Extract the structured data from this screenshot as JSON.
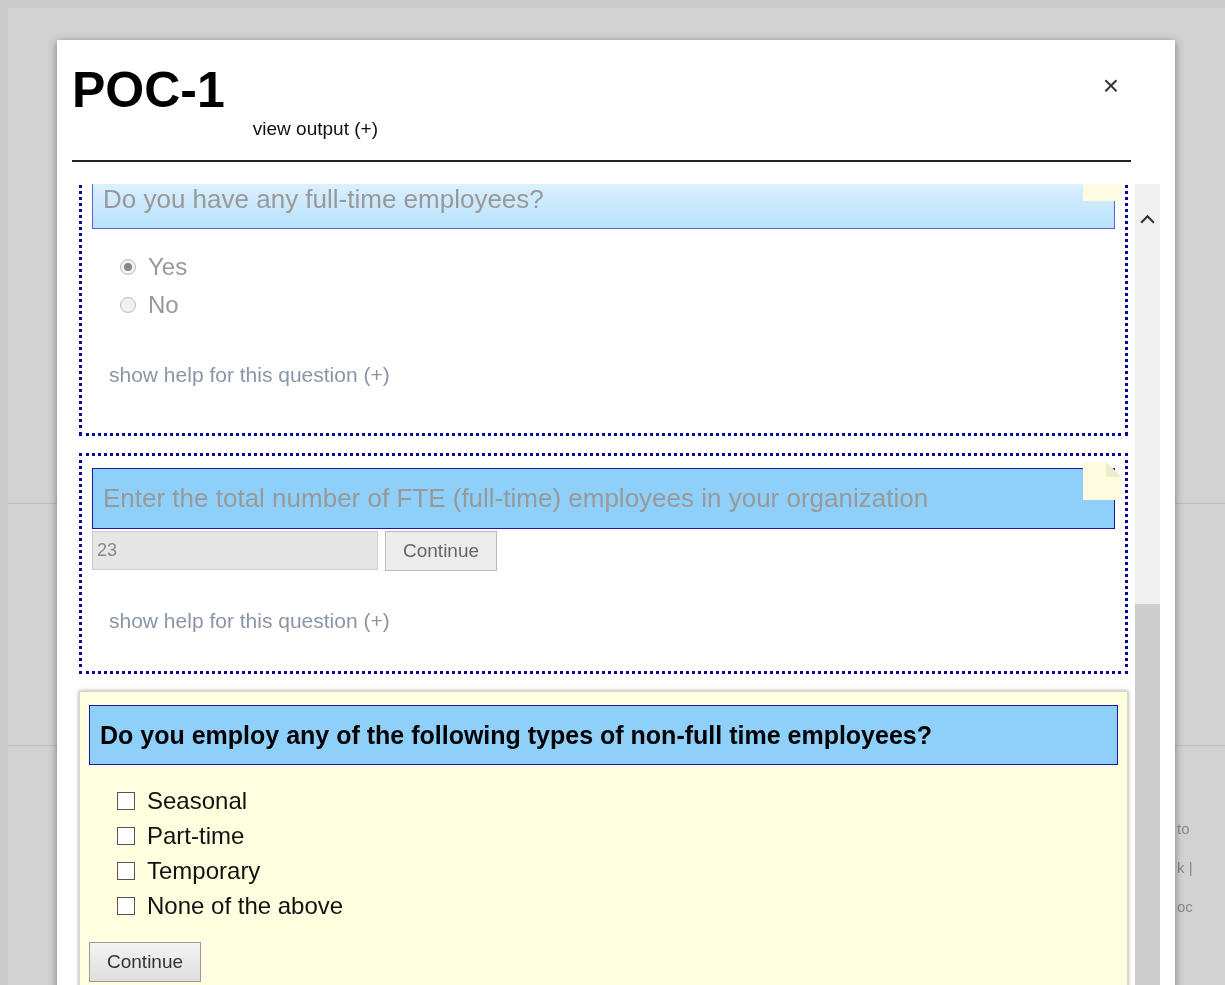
{
  "dialog": {
    "title": "POC-1",
    "output_link": "view output (+)",
    "close": "×"
  },
  "questions": [
    {
      "kind": "radio",
      "answered": true,
      "title": "Do you have any full-time employees?",
      "options": [
        {
          "label": "Yes",
          "selected": true
        },
        {
          "label": "No",
          "selected": false
        }
      ],
      "help": "show help for this question (+)"
    },
    {
      "kind": "number",
      "answered": true,
      "title": "Enter the total number of FTE (full-time) employees in your organization",
      "value": "23",
      "button": "Continue",
      "help": "show help for this question (+)"
    },
    {
      "kind": "checkbox",
      "answered": false,
      "title": "Do you employ any of the following types of non-full time employees?",
      "options": [
        {
          "label": "Seasonal",
          "checked": false
        },
        {
          "label": "Part-time",
          "checked": false
        },
        {
          "label": "Temporary",
          "checked": false
        },
        {
          "label": "None of the above",
          "checked": false
        }
      ],
      "button": "Continue"
    }
  ],
  "background_text": [
    "to",
    "k |",
    "oc"
  ]
}
